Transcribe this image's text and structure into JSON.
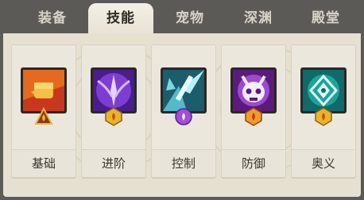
{
  "tabs": [
    {
      "label": "装备",
      "active": false
    },
    {
      "label": "技能",
      "active": true
    },
    {
      "label": "宠物",
      "active": false
    },
    {
      "label": "深渊",
      "active": false
    },
    {
      "label": "殿堂",
      "active": false
    }
  ],
  "skills": [
    {
      "label": "基础",
      "icon": "fist-icon",
      "badge": "flame-triangle-icon"
    },
    {
      "label": "进阶",
      "icon": "purple-wings-icon",
      "badge": "gold-gem-icon"
    },
    {
      "label": "控制",
      "icon": "ice-sword-icon",
      "badge": "purple-gem-icon"
    },
    {
      "label": "防御",
      "icon": "skull-icon",
      "badge": "orange-gem-icon"
    },
    {
      "label": "奥义",
      "icon": "teal-emblem-icon",
      "badge": "gold-gem-icon"
    }
  ]
}
